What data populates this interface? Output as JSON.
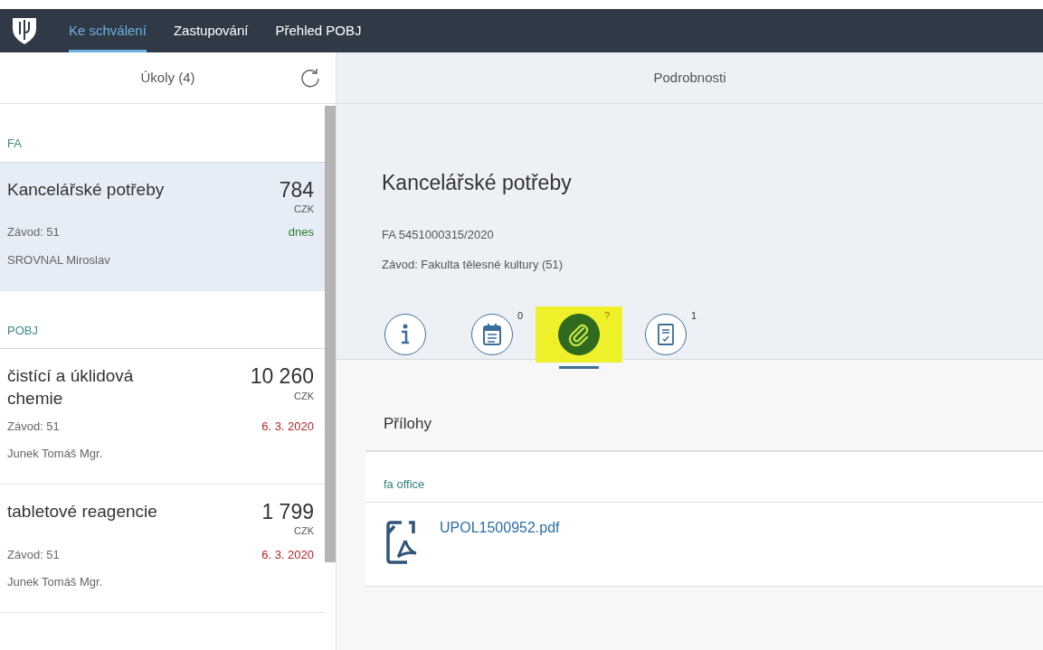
{
  "navbar": {
    "tabs": [
      {
        "label": "Ke schválení",
        "selected": true
      },
      {
        "label": "Zastupování",
        "selected": false
      },
      {
        "label": "Přehled POBJ",
        "selected": false
      }
    ]
  },
  "master": {
    "title": "Úkoly (4)",
    "groups": [
      {
        "label": "FA",
        "items": [
          {
            "title": "Kancelářské potřeby",
            "amount": "784",
            "currency": "CZK",
            "plant": "Závod: 51",
            "due": "dnes",
            "color": "#2b7d2b",
            "person": "SROVNAL Miroslav",
            "selected": true
          }
        ]
      },
      {
        "label": "POBJ",
        "items": [
          {
            "title": "čistící a úklidová chemie",
            "amount": "10 260",
            "currency": "CZK",
            "plant": "Závod: 51",
            "due": "6. 3. 2020",
            "color": "#b0242a",
            "person": "Junek Tomáš Mgr.",
            "selected": false
          },
          {
            "title": "tabletové reagencie",
            "amount": "1 799",
            "currency": "CZK",
            "plant": "Závod: 51",
            "due": "6. 3. 2020",
            "color": "#b0242a",
            "person": "Junek Tomáš Mgr.",
            "selected": false
          }
        ]
      }
    ]
  },
  "detail": {
    "title": "Podrobnosti",
    "object_title": "Kancelářské potřeby",
    "attributes": [
      "FA 5451000315/2020",
      "Závod: Fakulta tělesné kultury (51)"
    ],
    "tabs": [
      {
        "kind": "info",
        "selected": false,
        "highlighted": false
      },
      {
        "kind": "notes",
        "count": "0",
        "selected": false,
        "highlighted": false
      },
      {
        "kind": "attachments",
        "count": "?",
        "selected": true,
        "highlighted": true
      },
      {
        "kind": "approval",
        "count": "1",
        "selected": false,
        "highlighted": false
      }
    ],
    "attachments": {
      "title": "Přílohy",
      "group": "fa office",
      "files": [
        {
          "name": "UPOL1500952.pdf"
        }
      ]
    }
  }
}
